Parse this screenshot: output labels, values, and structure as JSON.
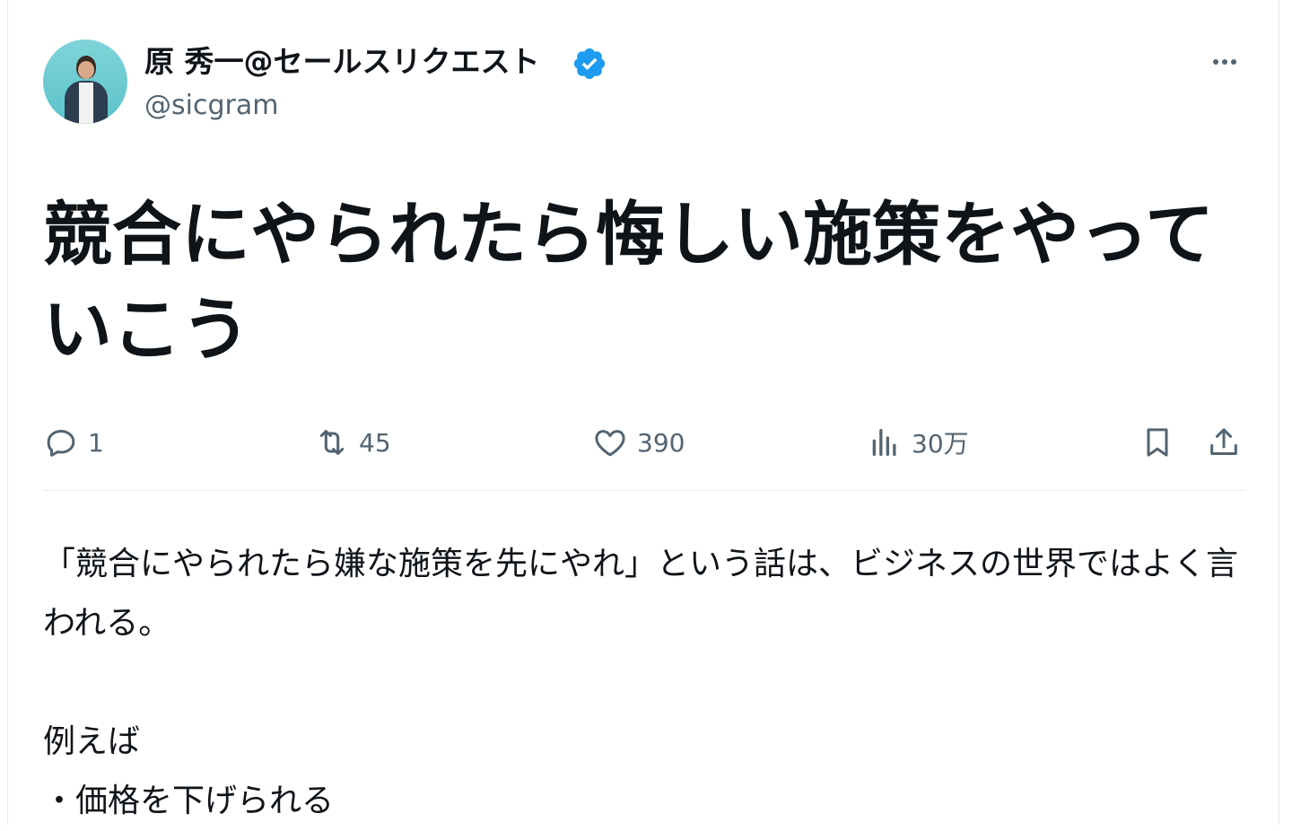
{
  "author": {
    "display_name": "原 秀一@セールスリクエスト",
    "handle": "@sicgram",
    "verified": true,
    "avatar_icon": "profile-photo",
    "verified_color": "#1d9bf0"
  },
  "post": {
    "headline": "競合にやられたら悔しい施策をやっていこう",
    "body": {
      "paragraph_1": "「競合にやられたら嫌な施策を先にやれ」という話は、ビジネスの世界ではよく言われる。",
      "line_2": "例えば",
      "line_3": "・価格を下げられる"
    }
  },
  "actions": {
    "reply": {
      "icon": "reply-icon",
      "count": "1"
    },
    "repost": {
      "icon": "repost-icon",
      "count": "45"
    },
    "like": {
      "icon": "heart-icon",
      "count": "390"
    },
    "views": {
      "icon": "views-icon",
      "count": "30万"
    },
    "bookmark": {
      "icon": "bookmark-icon"
    },
    "share": {
      "icon": "share-icon"
    }
  },
  "more_menu": {
    "icon": "more-icon"
  },
  "colors": {
    "text_primary": "#0f1419",
    "text_secondary": "#536471",
    "divider": "#e6ecf0"
  }
}
